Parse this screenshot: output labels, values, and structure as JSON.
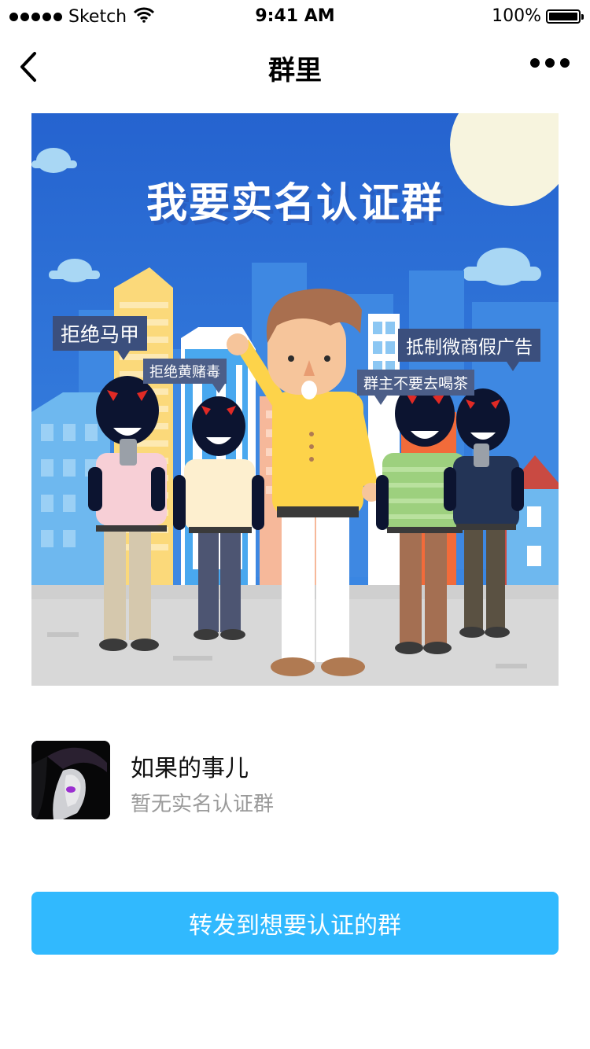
{
  "status_bar": {
    "carrier": "Sketch",
    "time": "9:41 AM",
    "battery": "100%",
    "battery_level": 1.0,
    "icons": [
      "signal-dots-icon",
      "wifi-icon",
      "battery-icon"
    ]
  },
  "nav": {
    "title": "群里",
    "back_icon": "chevron-left-icon",
    "more_icon": "more-dots-icon"
  },
  "poster": {
    "title": "我要实名认证群",
    "bubbles": [
      "拒绝马甲",
      "拒绝黄赌毒",
      "抵制微商假广告",
      "群主不要去喝茶"
    ]
  },
  "profile": {
    "name": "如果的事儿",
    "status": "暂无实名认证群"
  },
  "actions": {
    "forward_label": "转发到想要认证的群"
  },
  "colors": {
    "accent": "#31b9fe",
    "poster_sky": "#2f74d6",
    "bubble": "#3b4f7d",
    "secondary_text": "#9a9a9a"
  }
}
